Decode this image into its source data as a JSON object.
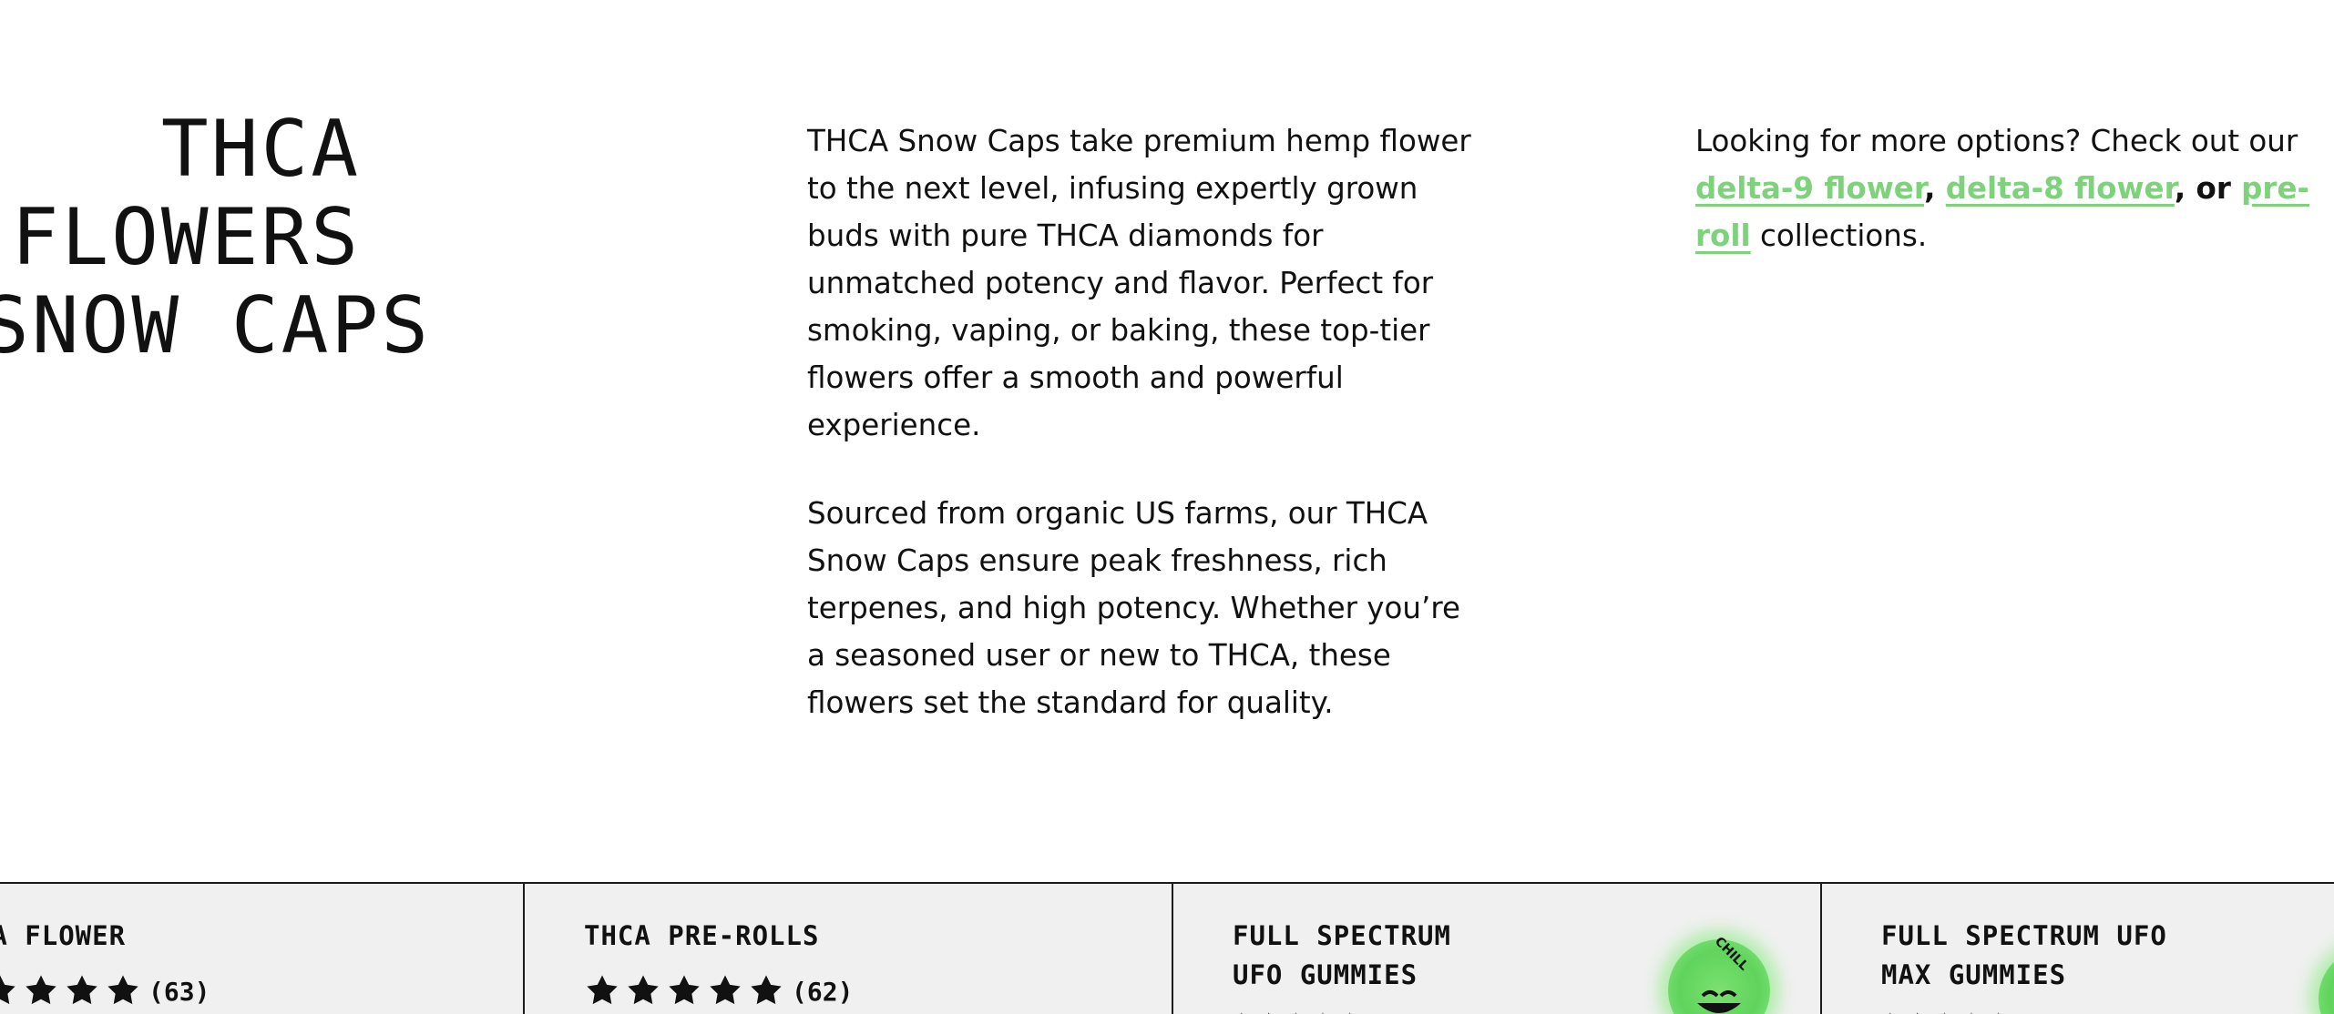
{
  "heading": "THCA\nFLOWERS\nSNOW CAPS",
  "intro": {
    "p1": "THCA Snow Caps take premium hemp flower to the next level, infusing expertly grown buds with pure THCA diamonds for unmatched potency and flavor. Perfect for smoking, vaping, or baking, these top-tier flowers offer a smooth and powerful experience.",
    "p2": "Sourced from organic US farms, our THCA Snow Caps ensure peak freshness, rich terpenes, and high potency. Whether you’re a seasoned user or new to THCA, these flowers set the standard for quality."
  },
  "more_options": {
    "lead": "Looking for more options? Check out our ",
    "link1": "delta-9 flower",
    "sep1": ", ",
    "link2": "delta-8 flower",
    "sep2": ", or ",
    "link3": "pre-roll",
    "tail": " collections."
  },
  "products": [
    {
      "title": "THCA FLOWER",
      "stars": 5,
      "count": "(63)"
    },
    {
      "title": "THCA PRE-ROLLS",
      "stars": 5,
      "count": "(62)"
    },
    {
      "title": "FULL SPECTRUM\nUFO GUMMIES",
      "badge": "CHILL"
    },
    {
      "title": "FULL SPECTRUM UFO\nMAX GUMMIES"
    }
  ],
  "colors": {
    "link": "#7fd27c",
    "text": "#111111",
    "card_bg": "#f0f0f0",
    "badge_green": "#5fd45c"
  },
  "icons": {
    "star": "star-icon",
    "badge_face": "relaxed-face-icon"
  }
}
